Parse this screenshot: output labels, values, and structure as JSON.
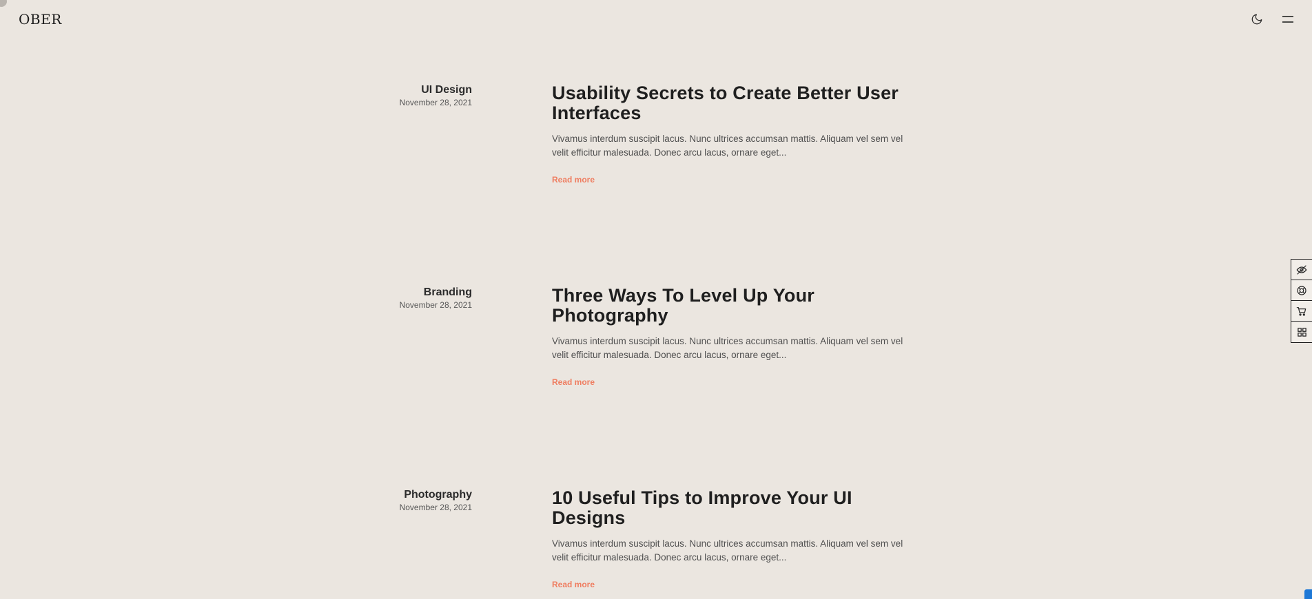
{
  "header": {
    "logo": "OBER",
    "icons": [
      "moon-icon",
      "hamburger-menu-icon"
    ]
  },
  "posts": [
    {
      "category": "UI Design",
      "date": "November 28, 2021",
      "title": "Usability Secrets to Create Better User Interfaces",
      "excerpt": "Vivamus interdum suscipit lacus. Nunc ultrices accumsan mattis. Aliquam vel sem vel velit efficitur malesuada. Donec arcu lacus, ornare eget...",
      "read_more": "Read more"
    },
    {
      "category": "Branding",
      "date": "November 28, 2021",
      "title": "Three Ways To Level Up Your Photography",
      "excerpt": "Vivamus interdum suscipit lacus. Nunc ultrices accumsan mattis. Aliquam vel sem vel velit efficitur malesuada. Donec arcu lacus, ornare eget...",
      "read_more": "Read more"
    },
    {
      "category": "Photography",
      "date": "November 28, 2021",
      "title": "10 Useful Tips to Improve Your UI Designs",
      "excerpt": "Vivamus interdum suscipit lacus. Nunc ultrices accumsan mattis. Aliquam vel sem vel velit efficitur malesuada. Donec arcu lacus, ornare eget...",
      "read_more": "Read more"
    }
  ],
  "side_toolbar": {
    "icons": [
      "eye-off-icon",
      "lifebuoy-icon",
      "cart-icon",
      "grid-icon"
    ]
  },
  "colors": {
    "background": "#ebe6e0",
    "accent": "#ef7d60",
    "text": "#1f1f1f"
  }
}
